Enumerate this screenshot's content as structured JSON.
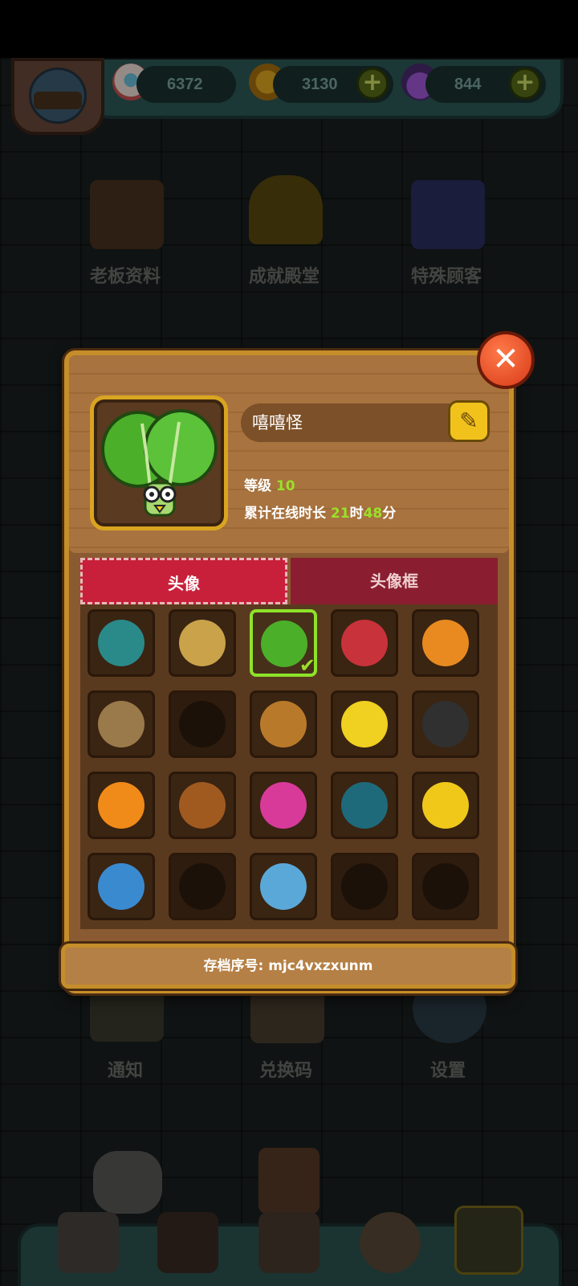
{
  "resources": {
    "eyeballs": "6372",
    "coins": "3130",
    "potions": "844"
  },
  "menu": {
    "boss_profile": "老板资料",
    "achievements": "成就殿堂",
    "special_customers": "特殊顾客",
    "notifications": "通知",
    "redeem_code": "兑换码",
    "settings": "设置"
  },
  "profile": {
    "name": "嘻嘻怪",
    "level_label": "等级",
    "level_value": "10",
    "online_label": "累计在线时长",
    "hours": "21",
    "hours_unit": "时",
    "minutes": "48",
    "minutes_unit": "分"
  },
  "tabs": {
    "avatar": "头像",
    "avatar_frame": "头像框"
  },
  "avatars": [
    {
      "icon": "teal-bird-avatar",
      "color": "#2a8a8a",
      "locked": false
    },
    {
      "icon": "wheat-bundle-avatar",
      "color": "#c9a24a",
      "locked": false
    },
    {
      "icon": "lettuce-monster-avatar",
      "color": "#4caf2a",
      "locked": false,
      "selected": true
    },
    {
      "icon": "red-toad-avatar",
      "color": "#c8323a",
      "locked": false
    },
    {
      "icon": "mushroom-creature-avatar",
      "color": "#e88a20",
      "locked": false
    },
    {
      "icon": "sack-creature-avatar",
      "color": "#9a7a4a",
      "locked": false
    },
    {
      "icon": "locked-avatar",
      "color": "#1c1108",
      "locked": true
    },
    {
      "icon": "monkey-avatar",
      "color": "#b87a2a",
      "locked": false
    },
    {
      "icon": "chick-avatar",
      "color": "#f0d020",
      "locked": false
    },
    {
      "icon": "cow-avatar",
      "color": "#303030",
      "locked": false
    },
    {
      "icon": "pumpkin-avatar",
      "color": "#f08a18",
      "locked": false
    },
    {
      "icon": "bull-avatar",
      "color": "#a05a20",
      "locked": false
    },
    {
      "icon": "pink-plant-monster-avatar",
      "color": "#d83a9a",
      "locked": false
    },
    {
      "icon": "sea-urchin-avatar",
      "color": "#1e6a7a",
      "locked": false
    },
    {
      "icon": "banana-octopus-avatar",
      "color": "#f0c81a",
      "locked": false
    },
    {
      "icon": "blue-slug-avatar",
      "color": "#3a8ad0",
      "locked": false
    },
    {
      "icon": "locked-avatar",
      "color": "#1c1108",
      "locked": true
    },
    {
      "icon": "blue-beast-avatar",
      "color": "#5aa8d8",
      "locked": false
    },
    {
      "icon": "locked-avatar",
      "color": "#1c1108",
      "locked": true
    },
    {
      "icon": "locked-avatar",
      "color": "#1c1108",
      "locked": true
    }
  ],
  "save_id": "存档序号: mjc4vxzxunm",
  "colors": {
    "accent_green": "#9be02a",
    "tab_red": "#c8203a",
    "wood": "#a8733f",
    "gold_border": "#c58e2a"
  }
}
